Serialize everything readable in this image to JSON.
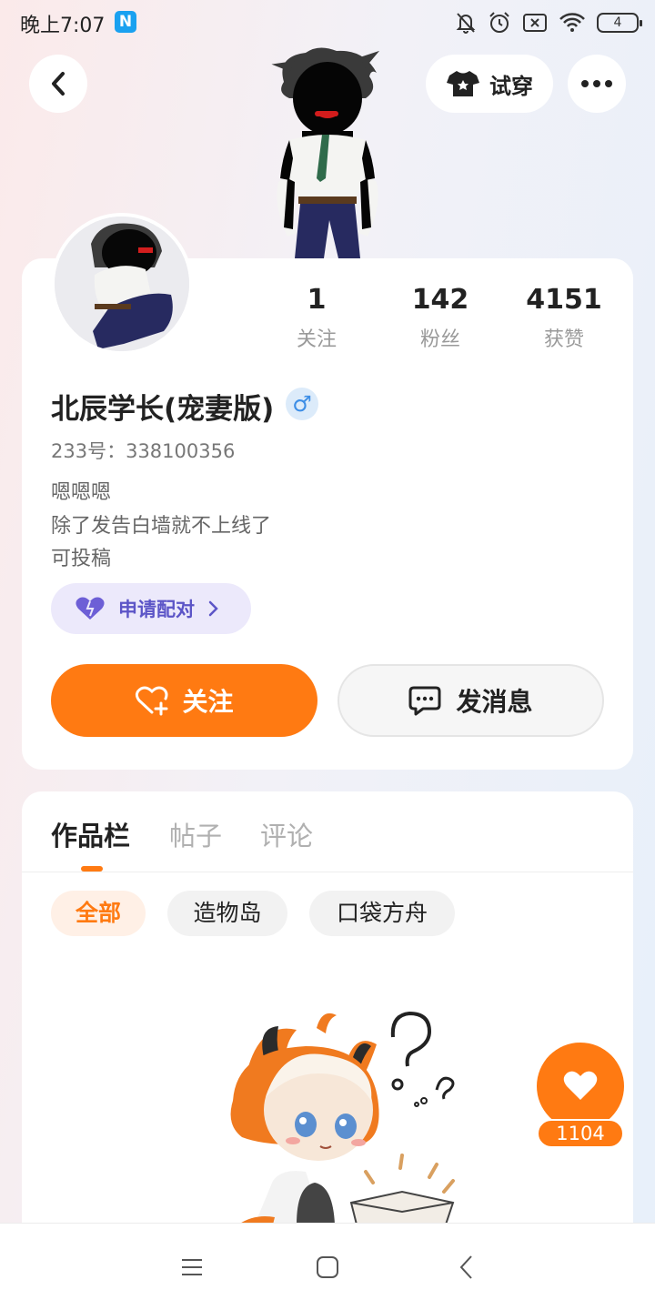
{
  "status_bar": {
    "time": "晚上7:07",
    "app_badge": "N",
    "battery": "4",
    "icons": [
      "mute-bell-icon",
      "alarm-icon",
      "sim-off-icon",
      "wifi-icon",
      "battery-icon"
    ]
  },
  "header": {
    "tryon_label": "试穿"
  },
  "profile": {
    "stats": [
      {
        "value": "1",
        "label": "关注"
      },
      {
        "value": "142",
        "label": "粉丝"
      },
      {
        "value": "4151",
        "label": "获赞"
      }
    ],
    "username": "北辰学长(宠妻版)",
    "gender_symbol": "♂",
    "uid": "233号：338100356",
    "bio": [
      "嗯嗯嗯",
      "除了发告白墙就不上线了",
      "可投稿"
    ],
    "pair_label": "申请配对",
    "follow_label": "关注",
    "message_label": "发消息"
  },
  "works": {
    "tabs": [
      {
        "label": "作品栏",
        "active": true
      },
      {
        "label": "帖子",
        "active": false
      },
      {
        "label": "评论",
        "active": false
      }
    ],
    "filters": [
      {
        "label": "全部",
        "active": true
      },
      {
        "label": "造物岛",
        "active": false
      },
      {
        "label": "口袋方舟",
        "active": false
      }
    ]
  },
  "float_like": {
    "count": "1104"
  },
  "colors": {
    "accent": "#ff7a12",
    "pair": "#5c55c7",
    "gender": "#3d8ee6"
  }
}
